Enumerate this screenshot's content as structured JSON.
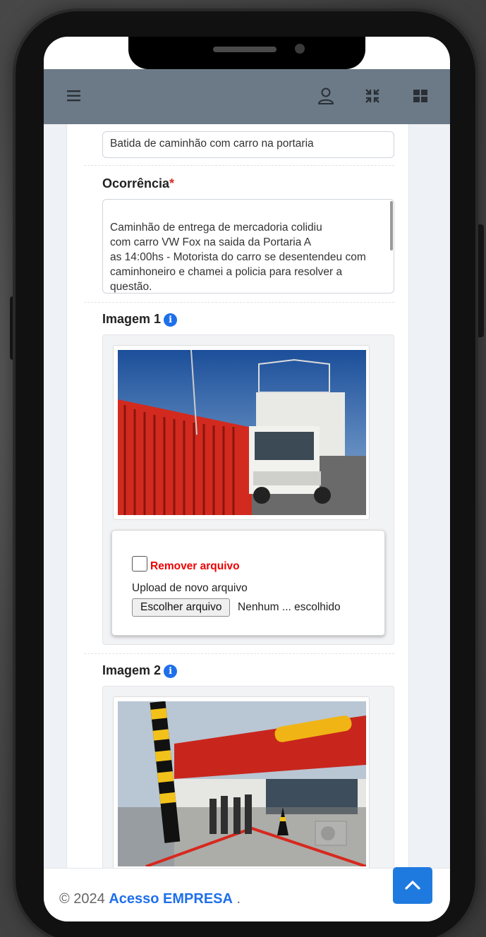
{
  "topbar": {
    "menu_icon": "hamburger-icon",
    "user_icon": "user-icon",
    "compress_icon": "compress-icon",
    "grid_icon": "grid-icon"
  },
  "form": {
    "title_value": "Batida de caminhão com carro na portaria",
    "ocorrencia_label": "Ocorrência",
    "required_mark": "*",
    "ocorrencia_text": "Caminhão de entrega de mercadoria colidiu\ncom carro VW Fox na saida da Portaria A\n as 14:00hs - Motorista do carro se desentendeu com\ncaminhoneiro e chamei a policia para resolver a\nquestão.",
    "images": [
      {
        "label": "Imagem 1",
        "info_icon": "info-icon",
        "remove_label": "Remover arquivo",
        "upload_label": "Upload de novo arquivo",
        "file_button": "Escolher arquivo",
        "file_name": "Nenhum ... escolhido"
      },
      {
        "label": "Imagem 2",
        "info_icon": "info-icon"
      }
    ]
  },
  "footer": {
    "copyright": "© 2024 ",
    "brand": "Acesso EMPRESA",
    "suffix": " ."
  },
  "colors": {
    "topbar": "#6c7a87",
    "accent": "#1f6feb",
    "danger": "#e00000"
  }
}
